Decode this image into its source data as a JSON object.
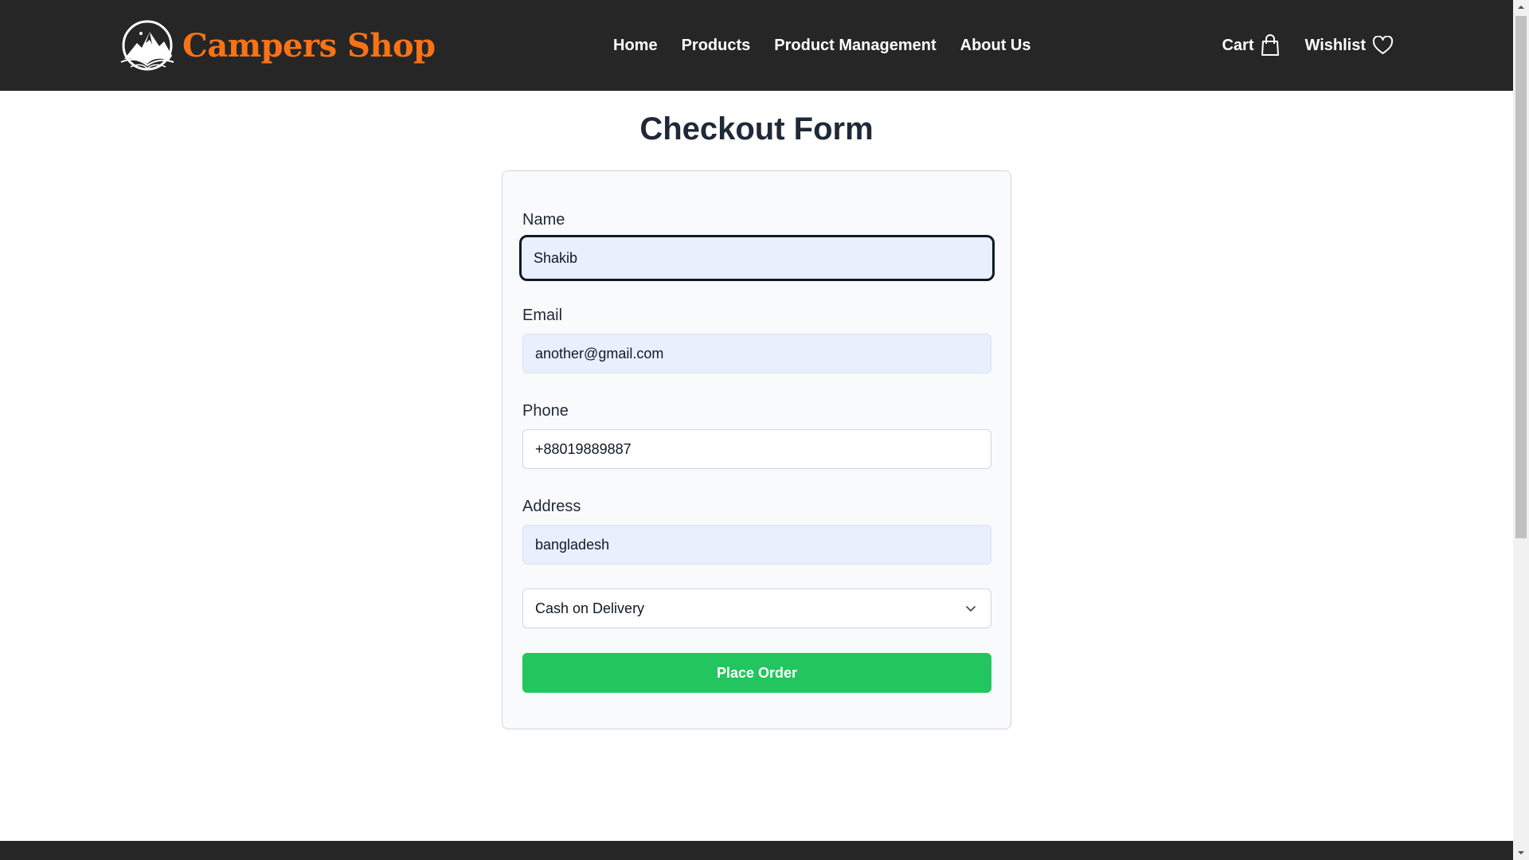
{
  "brand": {
    "name": "Campers Shop",
    "logo_icon": "mountain-moon-logo",
    "accent_color": "#f97316"
  },
  "nav": {
    "links": [
      "Home",
      "Products",
      "Product Management",
      "About Us"
    ],
    "cart_label": "Cart",
    "cart_icon": "shopping-bag-icon",
    "wishlist_label": "Wishlist",
    "wishlist_icon": "heart-icon",
    "background_color": "#262626"
  },
  "form": {
    "title": "Checkout Form",
    "fields": {
      "name": {
        "label": "Name",
        "value": "Shakib"
      },
      "email": {
        "label": "Email",
        "value": "another@gmail.com"
      },
      "phone": {
        "label": "Phone",
        "value": "+88019889887"
      },
      "address": {
        "label": "Address",
        "value": "bangladesh"
      }
    },
    "payment_method": {
      "selected": "Cash on Delivery"
    },
    "submit_label": "Place Order",
    "submit_color": "#22c55e"
  }
}
